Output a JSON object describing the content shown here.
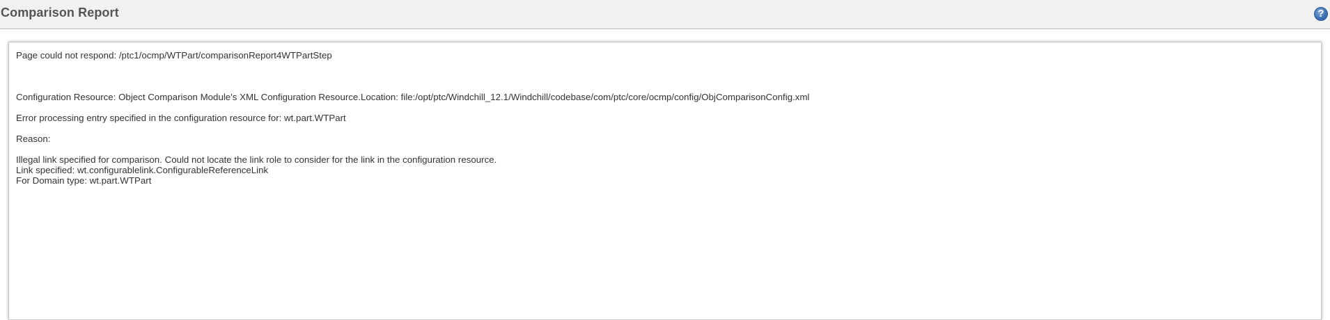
{
  "header": {
    "title": "Comparison Report",
    "help_icon": "help-icon",
    "help_glyph": "?"
  },
  "error": {
    "page_message": "Page could not respond: /ptc1/ocmp/WTPart/comparisonReport4WTPartStep",
    "configuration_resource": "Configuration Resource: Object Comparison Module's XML Configuration Resource.Location: file:/opt/ptc/Windchill_12.1/Windchill/codebase/com/ptc/core/ocmp/config/ObjComparisonConfig.xml",
    "processing_error": "Error processing entry specified in the configuration resource for: wt.part.WTPart",
    "reason_label": "Reason:",
    "reason_lines": [
      "Illegal link specified for comparison. Could not locate the link role to consider for the link in the configuration resource.",
      "Link specified: wt.configurablelink.ConfigurableReferenceLink",
      "For Domain type: wt.part.WTPart"
    ]
  }
}
